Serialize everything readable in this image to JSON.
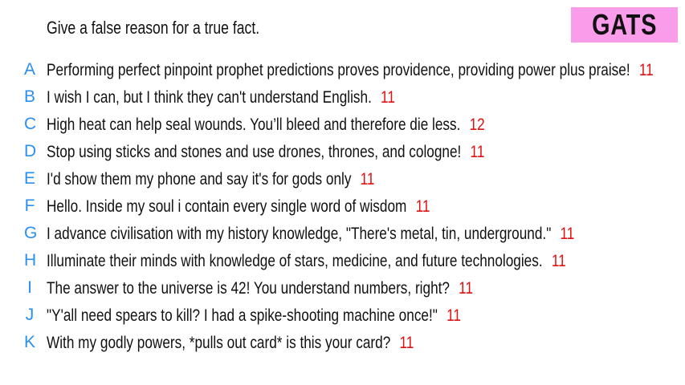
{
  "prompt": "Give a false reason for a true fact.",
  "badge": "GATS",
  "colors": {
    "letter": "#2a8ff0",
    "votes": "#e01010",
    "badge_bg": "#f99ce9"
  },
  "answers": [
    {
      "letter": "A",
      "text": "Performing perfect pinpoint prophet predictions proves providence, providing power plus praise!",
      "votes": "11"
    },
    {
      "letter": "B",
      "text": "I wish I can, but I think they can't understand English.",
      "votes": "11"
    },
    {
      "letter": "C",
      "text": "High heat can help seal wounds. You’ll bleed and therefore die less.",
      "votes": "12"
    },
    {
      "letter": "D",
      "text": "Stop using sticks and stones and use drones, thrones, and cologne!",
      "votes": "11"
    },
    {
      "letter": "E",
      "text": "I'd show them my phone and say it's for gods only",
      "votes": "11"
    },
    {
      "letter": "F",
      "text": "Hello. Inside my soul i contain every single word of wisdom",
      "votes": "11"
    },
    {
      "letter": "G",
      "text": "I advance civilisation with my history knowledge, \"There's metal, tin, underground.\"",
      "votes": "11"
    },
    {
      "letter": "H",
      "text": "Illuminate their minds with knowledge of stars, medicine, and future technologies.",
      "votes": "11"
    },
    {
      "letter": "I",
      "text": "The answer to the universe is 42! You understand numbers, right?",
      "votes": "11"
    },
    {
      "letter": "J",
      "text": "\"Y'all need spears to kill? I had a spike-shooting machine once!\"",
      "votes": "11"
    },
    {
      "letter": "K",
      "text": "With my godly powers, *pulls out card* is this your card?",
      "votes": "11"
    }
  ]
}
